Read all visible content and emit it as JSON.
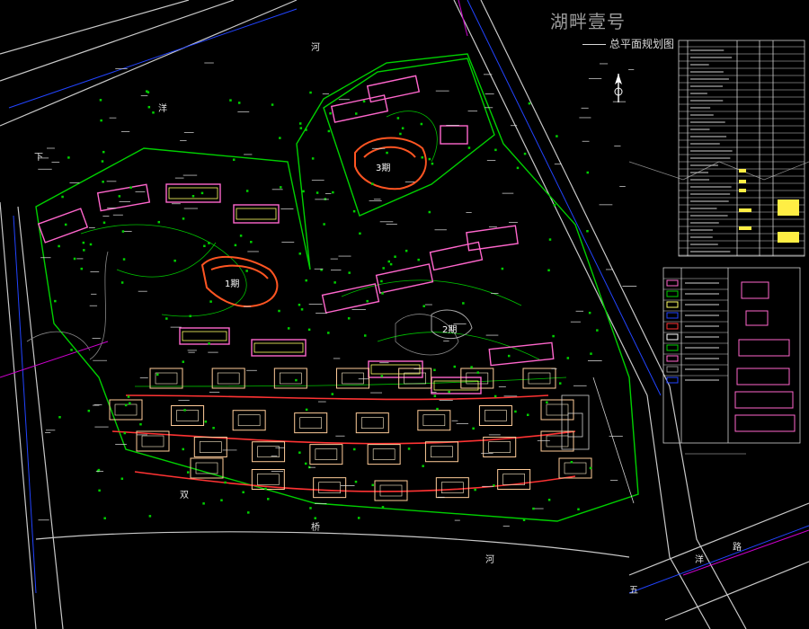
{
  "title": {
    "main": "湖畔壹号",
    "sub": "总平面规划图"
  },
  "road_labels": {
    "he": "河",
    "yang": "洋",
    "xia": "下",
    "shuang": "双",
    "qiao": "桥",
    "he2": "河",
    "wu": "五",
    "yang2": "洋",
    "lu": "路"
  },
  "phases": {
    "p1": "1期",
    "p2": "2期",
    "p3": "3期"
  },
  "colors": {
    "background": "#000000",
    "road": "#d0d0d0",
    "green": "#00d000",
    "building_pink": "#ff66cc",
    "building_yellow": "#ffff66",
    "villa_red": "#ff4444",
    "blue_line": "#2244ff",
    "magenta_line": "#ff00ff",
    "white": "#ffffff"
  },
  "icons": {
    "north_arrow": "north-arrow-icon"
  }
}
